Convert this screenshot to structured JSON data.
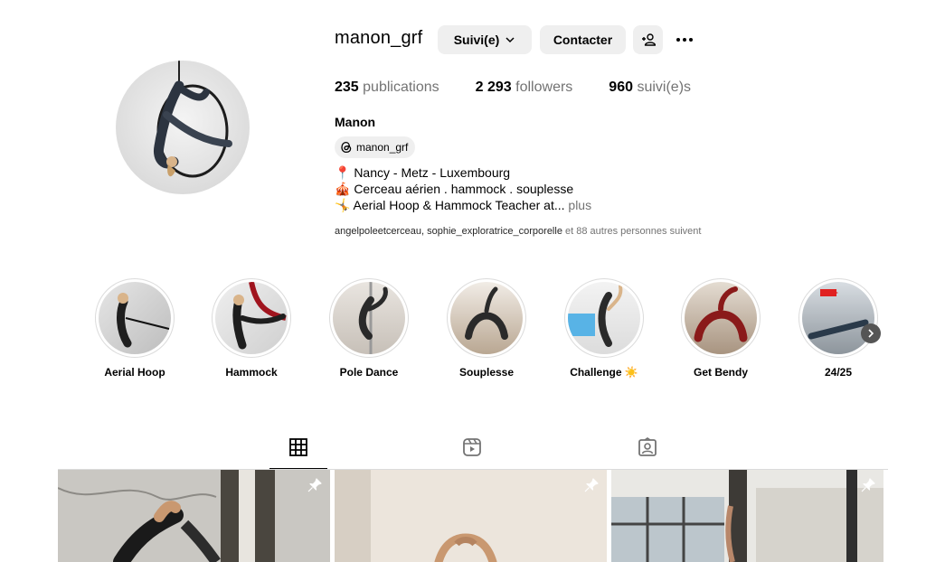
{
  "profile": {
    "username": "manon_grf",
    "full_name": "Manon",
    "threads_handle": "manon_grf",
    "bio_lines": [
      "📍 Nancy - Metz - Luxembourg",
      "🎪 Cerceau aérien . hammock . souplesse",
      "🤸 Aerial Hoop & Hammock Teacher at..."
    ],
    "bio_more": "plus"
  },
  "actions": {
    "follow_label": "Suivi(e)",
    "contact_label": "Contacter"
  },
  "stats": {
    "posts_count": "235",
    "posts_label": "publications",
    "followers_count": "2 293",
    "followers_label": "followers",
    "following_count": "960",
    "following_label": "suivi(e)s"
  },
  "followed_by": {
    "accounts": "angelpoleetcerceau, sophie_exploratrice_corporelle",
    "suffix": " et 88 autres personnes suivent"
  },
  "highlights": [
    {
      "label": "Aerial Hoop"
    },
    {
      "label": "Hammock"
    },
    {
      "label": "Pole Dance"
    },
    {
      "label": "Souplesse"
    },
    {
      "label": "Challenge ☀️"
    },
    {
      "label": "Get Bendy"
    },
    {
      "label": "24/25"
    }
  ],
  "tabs": [
    {
      "name": "posts-grid",
      "icon": "grid-icon",
      "active": true
    },
    {
      "name": "reels",
      "icon": "reels-icon",
      "active": false
    },
    {
      "name": "tagged",
      "icon": "tagged-icon",
      "active": false
    }
  ],
  "posts": [
    {
      "pinned": true
    },
    {
      "pinned": true
    },
    {
      "pinned": true
    }
  ]
}
